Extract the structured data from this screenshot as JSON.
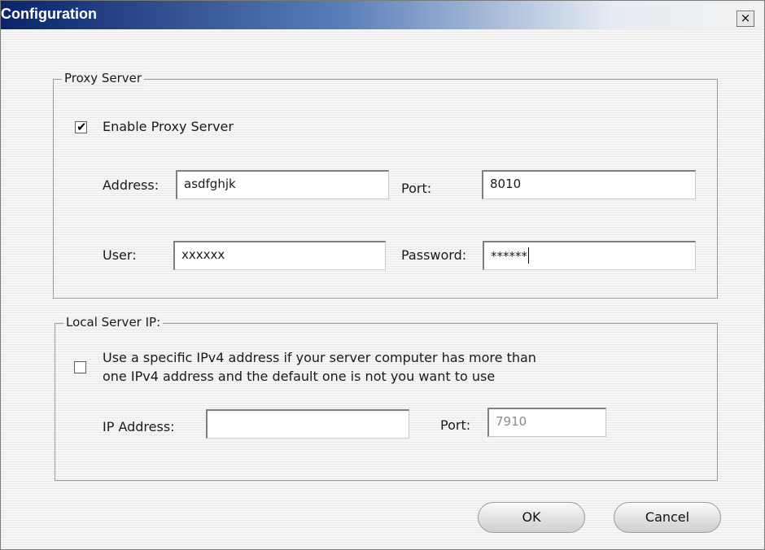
{
  "window": {
    "title": "Configuration",
    "close_glyph": "×"
  },
  "proxy": {
    "legend": "Proxy Server",
    "enable_checked": true,
    "enable_label": "Enable Proxy Server",
    "address_label": "Address:",
    "address_value": "asdfghjk",
    "port_label": "Port:",
    "port_value": "8010",
    "user_label": "User:",
    "user_value": "xxxxxx",
    "password_label": "Password:",
    "password_value": "******"
  },
  "local": {
    "legend": "Local Server IP:",
    "specific_checked": false,
    "specific_label_line1": "Use a specific IPv4 address if your server computer has more than",
    "specific_label_line2": "one IPv4 address and the default one is not you want to use",
    "ip_label": "IP Address:",
    "ip_value": "",
    "port_label": "Port:",
    "port_value": "7910"
  },
  "buttons": {
    "ok": "OK",
    "cancel": "Cancel"
  }
}
